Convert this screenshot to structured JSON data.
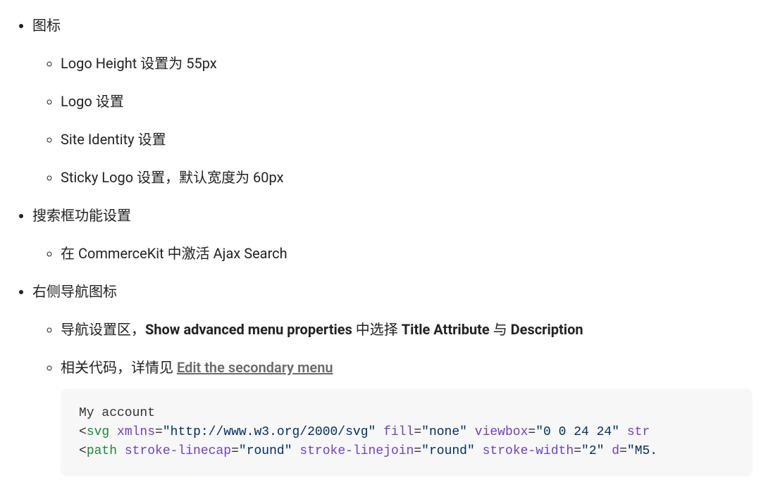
{
  "list": {
    "item1": {
      "label": "图标",
      "sub": [
        "Logo Height 设置为 55px",
        "Logo 设置",
        "Site Identity 设置",
        "Sticky Logo 设置，默认宽度为 60px"
      ]
    },
    "item2": {
      "label": "搜索框功能设置",
      "sub": [
        "在 CommerceKit 中激活 Ajax Search"
      ]
    },
    "item3": {
      "label": "右侧导航图标",
      "sub1": {
        "part1": "导航设置区，",
        "bold1": "Show advanced menu properties",
        "part2": " 中选择 ",
        "bold2": "Title Attribute",
        "part3": " 与 ",
        "bold3": "Description"
      },
      "sub2": {
        "part1": "相关代码，详情见 ",
        "link": "Edit the secondary menu"
      }
    }
  },
  "code": {
    "line1": "My account",
    "line2": {
      "open": "<",
      "tag": "svg",
      "sp": " ",
      "a1n": "xmlns",
      "eq": "=",
      "a1v": "\"http://www.w3.org/2000/svg\"",
      "a2n": "fill",
      "a2v": "\"none\"",
      "a3n": "viewbox",
      "a3v": "\"0 0 24 24\"",
      "a4n_partial": "str"
    },
    "line3": {
      "open": "<",
      "tag": "path",
      "a1n": "stroke-linecap",
      "a1v": "\"round\"",
      "a2n": "stroke-linejoin",
      "a2v": "\"round\"",
      "a3n": "stroke-width",
      "a3v": "\"2\"",
      "a4n": "d",
      "a4v_partial": "\"M5."
    }
  }
}
